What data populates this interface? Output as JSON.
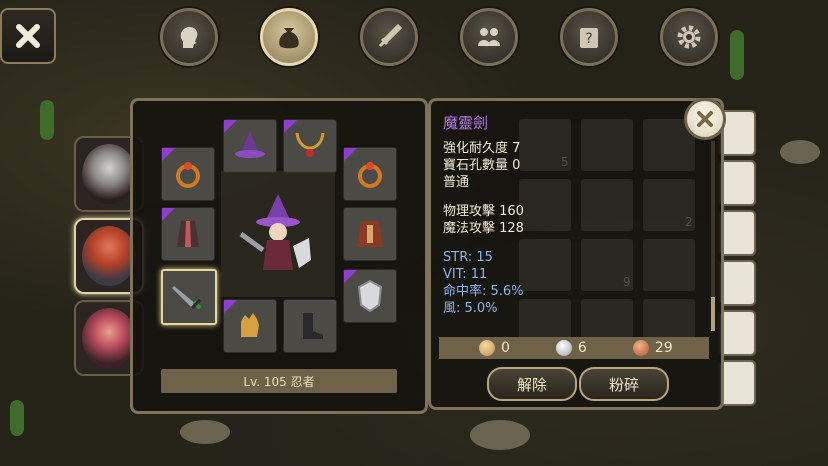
{
  "nav": {
    "tabs": [
      {
        "name": "character-tab",
        "icon": "head-silhouette-icon",
        "active": false
      },
      {
        "name": "bag-tab",
        "icon": "money-bag-icon",
        "active": true
      },
      {
        "name": "skill-tab",
        "icon": "sword-icon",
        "active": false
      },
      {
        "name": "party-tab",
        "icon": "people-icon",
        "active": false
      },
      {
        "name": "quest-tab",
        "icon": "scroll-question-icon",
        "active": false
      },
      {
        "name": "settings-tab",
        "icon": "gear-icon",
        "active": false
      }
    ]
  },
  "equipment": {
    "level_label": "Lv. 105 忍者"
  },
  "item": {
    "name": "魔靈劍",
    "lines": [
      "強化耐久度 7",
      "寶石孔數量 0",
      "普通"
    ],
    "attack": [
      "物理攻擊 160",
      "魔法攻擊 128"
    ],
    "stats": [
      "STR: 15",
      "VIT: 11",
      "命中率: 5.6%",
      "風: 5.0%"
    ]
  },
  "ghost_counts": [
    "5",
    "2",
    "9"
  ],
  "currency": {
    "gold": "0",
    "silver": "6",
    "copper": "29"
  },
  "actions": {
    "unequip_label": "解除",
    "smash_label": "粉碎"
  },
  "colors": {
    "rare_corner": "#8d3fd0",
    "item_name": "#b47ae6",
    "stat_blue": "#8db4ee"
  }
}
